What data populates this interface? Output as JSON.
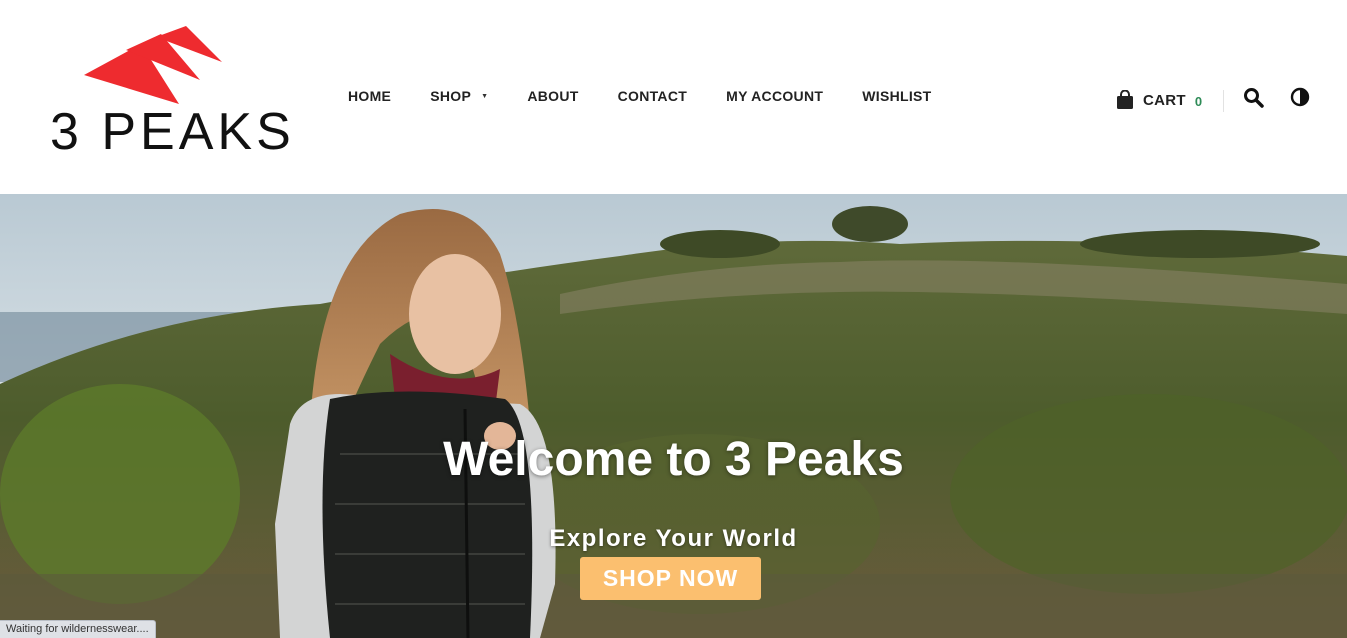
{
  "brand": {
    "name": "3 PEAKS",
    "logo_color": "#ee2b2f"
  },
  "nav": {
    "items": [
      {
        "label": "HOME"
      },
      {
        "label": "SHOP",
        "has_dropdown": true
      },
      {
        "label": "ABOUT"
      },
      {
        "label": "CONTACT"
      },
      {
        "label": "MY ACCOUNT"
      },
      {
        "label": "WISHLIST"
      }
    ]
  },
  "cart": {
    "label": "CART",
    "count": "0",
    "icon": "shopping-bag-icon"
  },
  "header_icons": {
    "search": "search-icon",
    "contrast": "contrast-icon"
  },
  "hero": {
    "title": "Welcome to 3 Peaks",
    "subtitle": "Explore Your World",
    "cta_label": "SHOP NOW",
    "cta_color": "#fbbf6f"
  },
  "status_bar": {
    "text": "Waiting for wildernesswear...."
  }
}
